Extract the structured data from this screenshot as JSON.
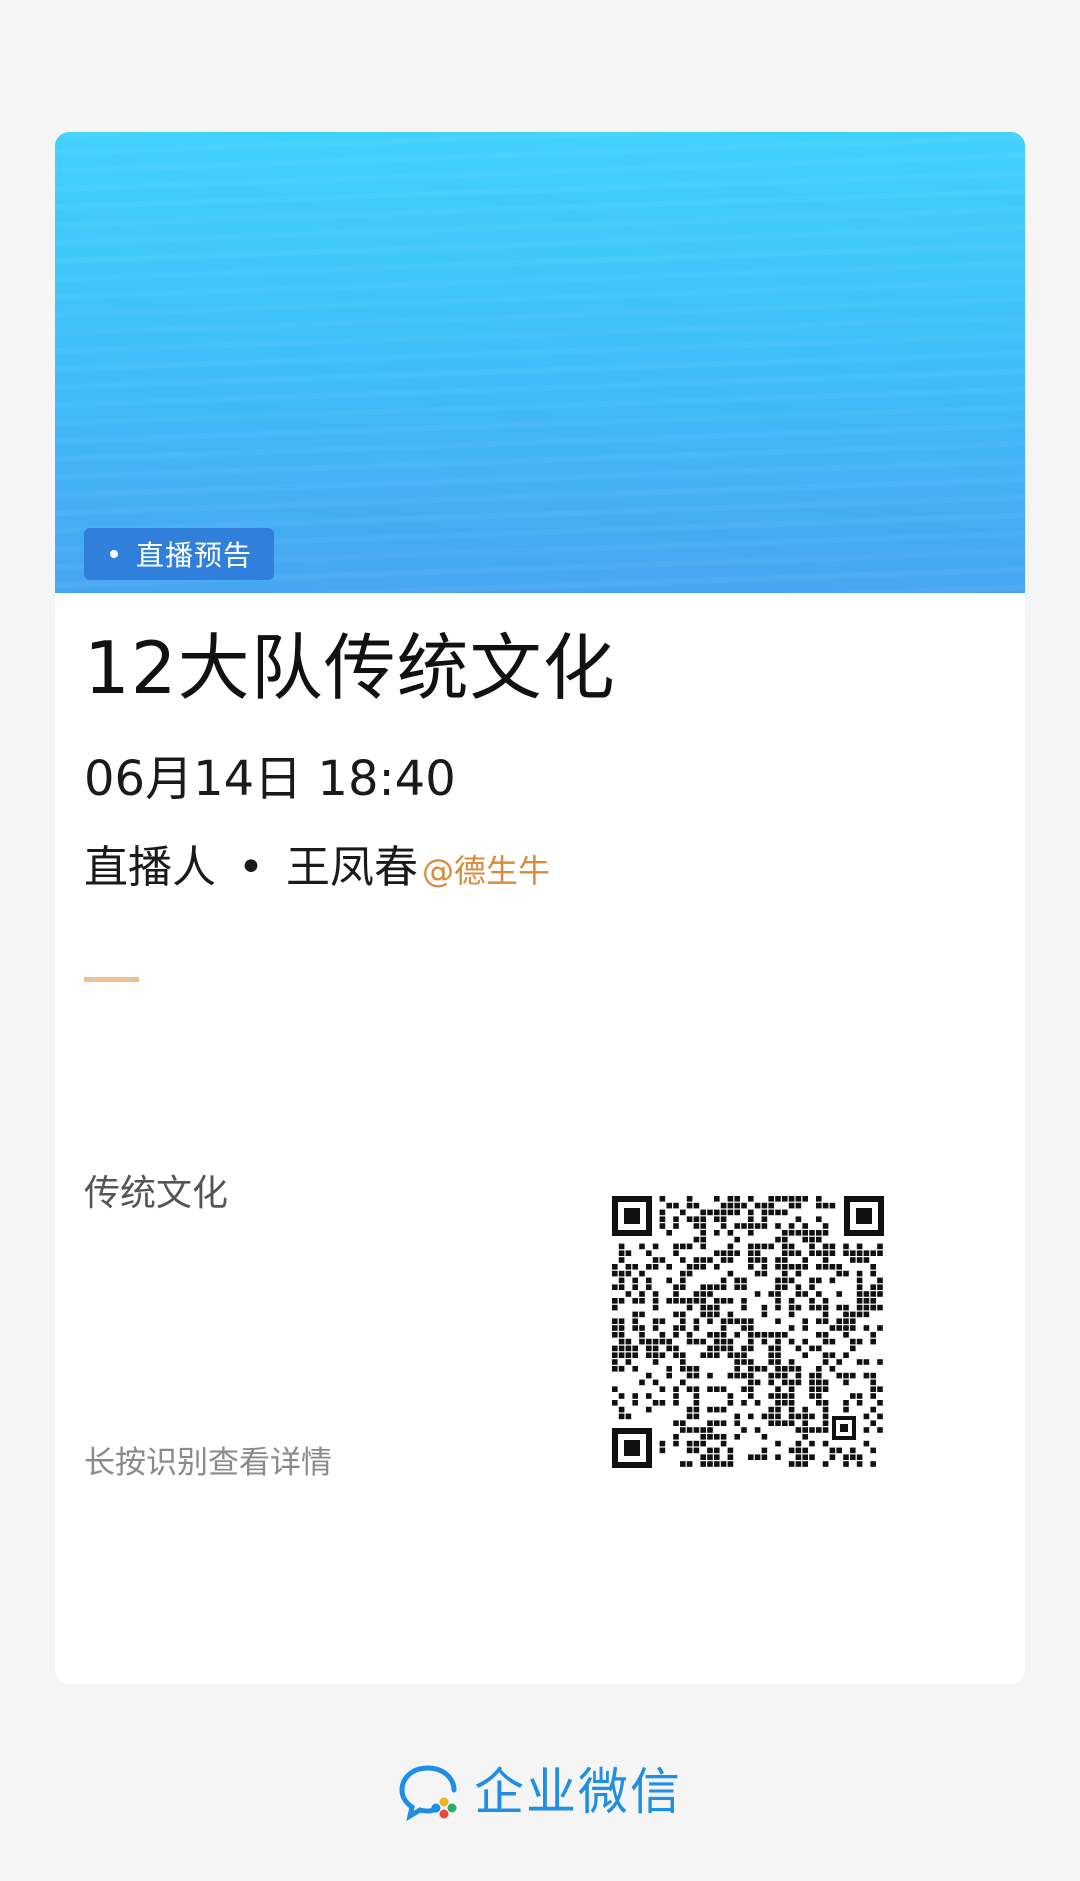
{
  "card": {
    "badge_label": "直播预告",
    "title": "12大队传统文化",
    "datetime": "06月14日 18:40",
    "host": {
      "label": "直播人",
      "separator": "•",
      "name": "王凤春",
      "org": "@德生牛"
    },
    "description": "传统文化",
    "hint": "长按识别查看详情"
  },
  "footer": {
    "brand": "企业微信"
  },
  "colors": {
    "badge": "#2f7fdb",
    "org_accent": "#d98b3c",
    "divider": "#e9c393",
    "brand": "#1f8fe5"
  },
  "icons": {
    "qr": "qr-code-icon",
    "brand": "wecom-logo-icon"
  }
}
